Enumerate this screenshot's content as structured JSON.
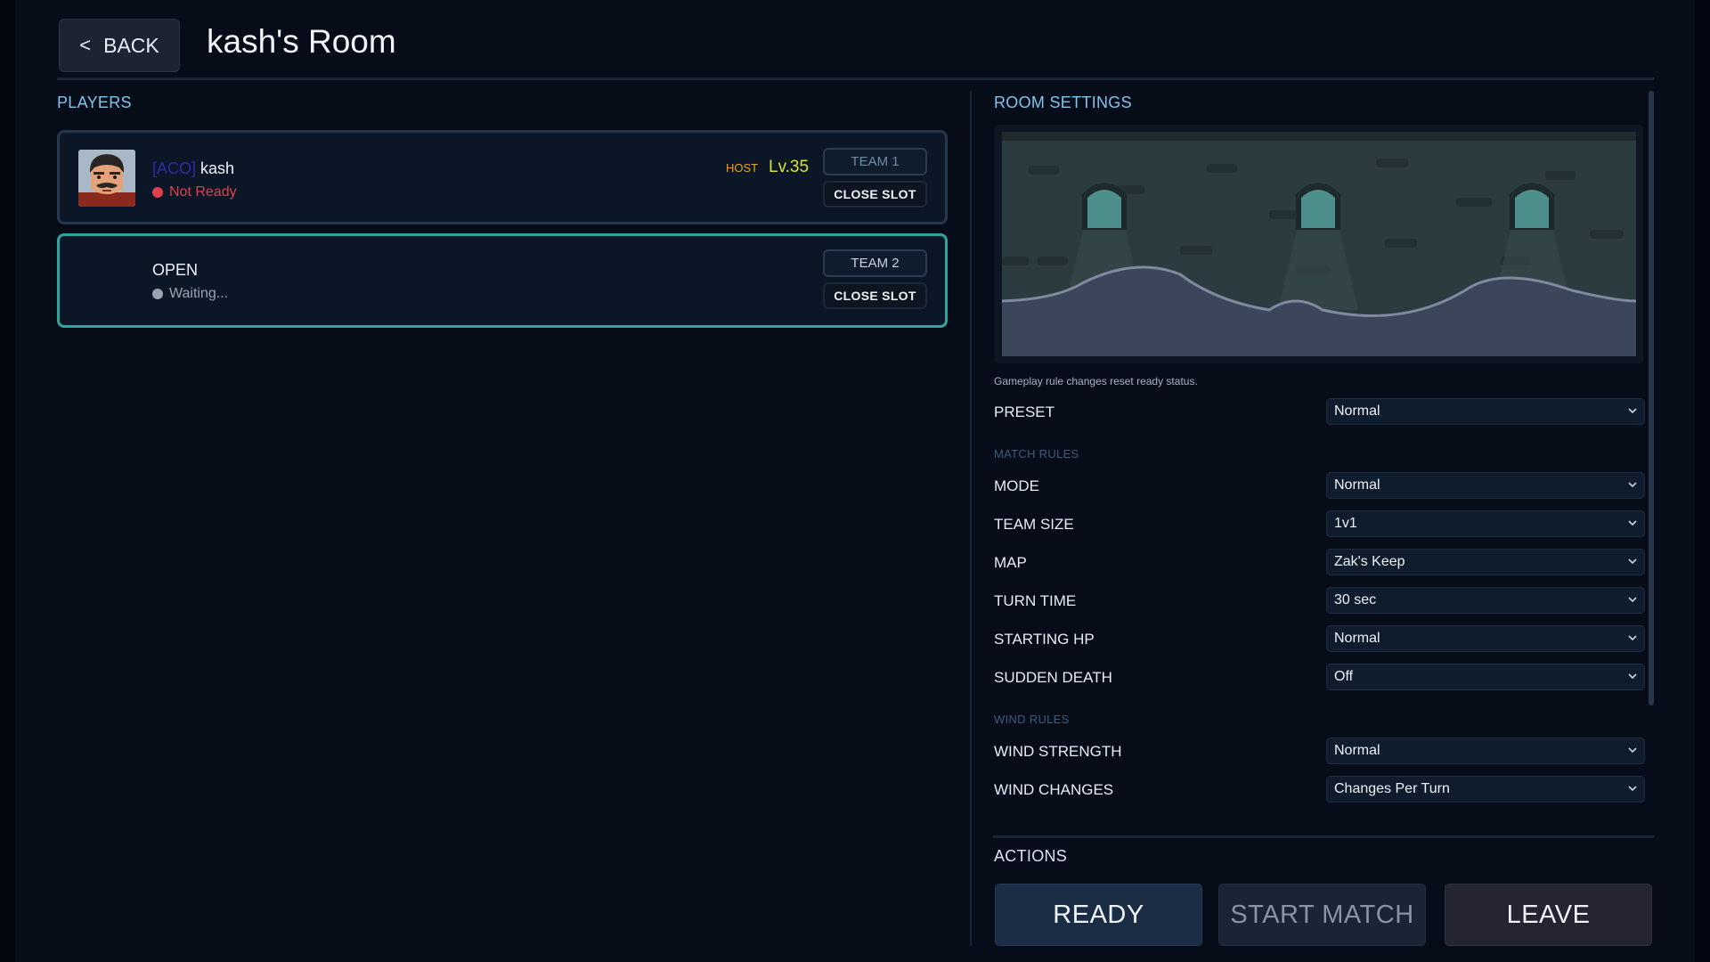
{
  "header": {
    "back_label": "BACK",
    "back_chevron": "<",
    "room_title": "kash's Room"
  },
  "players": {
    "section_label": "PLAYERS",
    "slots": [
      {
        "clan_tag": "[ACO]",
        "name": "kash",
        "status": "Not Ready",
        "status_color": "#e0404e",
        "host_label": "HOST",
        "level": "Lv.35",
        "team_label": "TEAM 1",
        "close_label": "CLOSE SLOT"
      },
      {
        "name": "OPEN",
        "status": "Waiting...",
        "status_color": "#9aa4b0",
        "team_label": "TEAM 2",
        "close_label": "CLOSE SLOT"
      }
    ]
  },
  "settings": {
    "section_label": "ROOM SETTINGS",
    "hint": "Gameplay rule changes reset ready status.",
    "preset": {
      "label": "PRESET",
      "value": "Normal"
    },
    "match_rules_label": "MATCH RULES",
    "match_rules": [
      {
        "label": "MODE",
        "value": "Normal"
      },
      {
        "label": "TEAM SIZE",
        "value": "1v1"
      },
      {
        "label": "MAP",
        "value": "Zak's Keep"
      },
      {
        "label": "TURN TIME",
        "value": "30 sec"
      },
      {
        "label": "STARTING HP",
        "value": "Normal"
      },
      {
        "label": "SUDDEN DEATH",
        "value": "Off"
      }
    ],
    "wind_rules_label": "WIND RULES",
    "wind_rules": [
      {
        "label": "WIND STRENGTH",
        "value": "Normal"
      },
      {
        "label": "WIND CHANGES",
        "value": "Changes Per Turn"
      }
    ]
  },
  "actions": {
    "section_label": "ACTIONS",
    "ready_label": "READY",
    "start_label": "START MATCH",
    "leave_label": "LEAVE"
  },
  "colors": {
    "accent": "#7fc6ee",
    "open_slot_border": "#2ea6a0",
    "level": "#d7e43a",
    "host": "#e9a326"
  }
}
